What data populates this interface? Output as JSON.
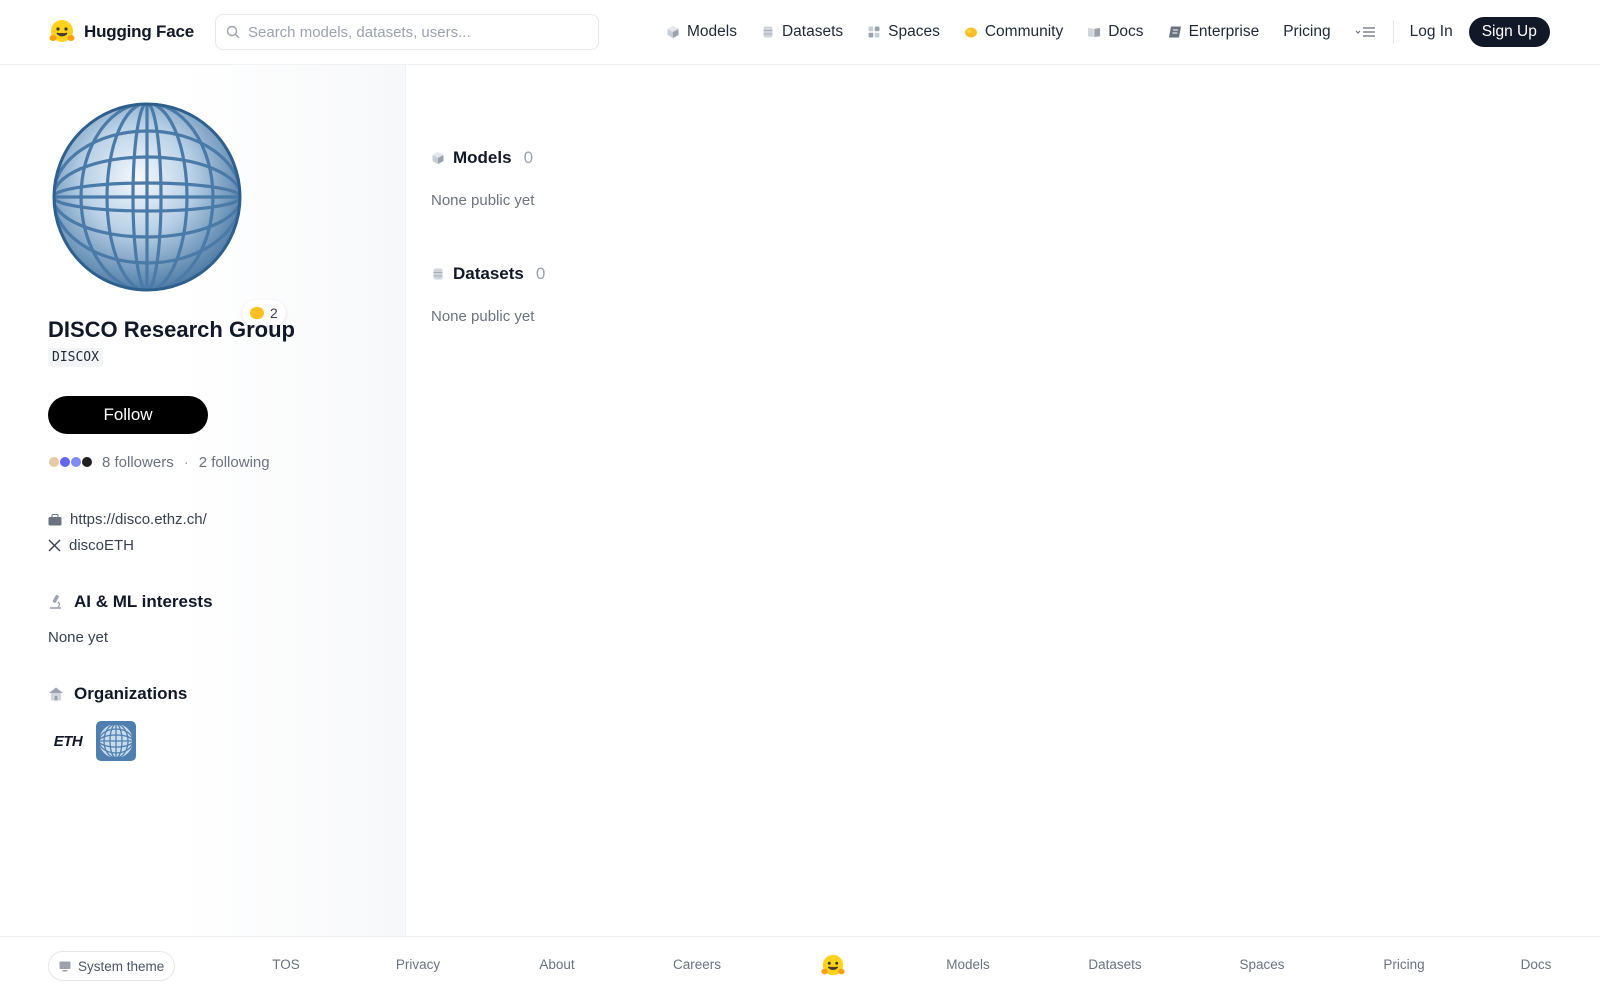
{
  "header": {
    "brand": "Hugging Face",
    "search_placeholder": "Search models, datasets, users...",
    "nav": [
      {
        "label": "Models",
        "icon": "cube-icon"
      },
      {
        "label": "Datasets",
        "icon": "database-icon"
      },
      {
        "label": "Spaces",
        "icon": "grid-icon"
      },
      {
        "label": "Community",
        "icon": "community-icon"
      },
      {
        "label": "Docs",
        "icon": "book-icon"
      },
      {
        "label": "Enterprise",
        "icon": "enterprise-icon"
      },
      {
        "label": "Pricing"
      }
    ],
    "login": "Log In",
    "signup": "Sign Up"
  },
  "profile": {
    "name": "DISCO Research Group",
    "handle": "DISCOX",
    "badge_count": "2",
    "follow_label": "Follow",
    "followers": "8 followers",
    "separator": "·",
    "following": "2 following",
    "website": "https://disco.ethz.ch/",
    "twitter": "discoETH",
    "interests_title": "AI & ML interests",
    "interests_value": "None yet",
    "organizations_title": "Organizations",
    "organizations": [
      {
        "name": "ETH",
        "logo_text": "ETH"
      },
      {
        "name": "DISCO Research Group"
      }
    ]
  },
  "main": {
    "models": {
      "title": "Models",
      "count": "0",
      "empty": "None public yet"
    },
    "datasets": {
      "title": "Datasets",
      "count": "0",
      "empty": "None public yet"
    }
  },
  "footer": {
    "theme": "System theme",
    "links": [
      "TOS",
      "Privacy",
      "About",
      "Careers",
      "Models",
      "Datasets",
      "Spaces",
      "Pricing",
      "Docs"
    ]
  },
  "colors": {
    "accent_dark": "#111827",
    "follow_button": "#000000",
    "muted_text": "#6b7280",
    "badge_yellow": "#fbbf24"
  }
}
